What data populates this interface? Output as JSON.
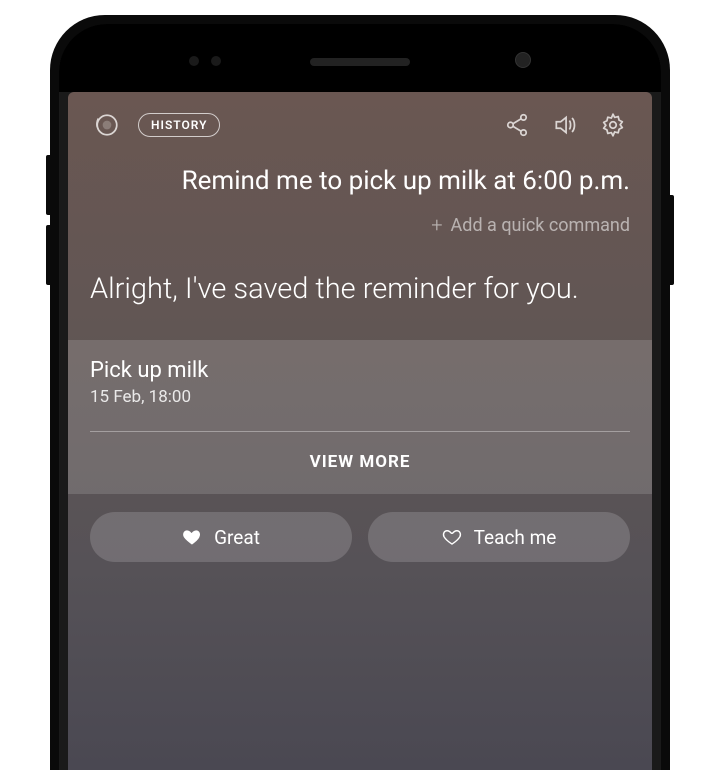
{
  "topbar": {
    "history_label": "HISTORY"
  },
  "conversation": {
    "user_utterance": "Remind me to pick up milk at 6:00 p.m.",
    "add_quick_command": "Add a quick command",
    "assistant_reply": "Alright, I've saved the reminder for you."
  },
  "reminder_card": {
    "title": "Pick up milk",
    "datetime": "15 Feb, 18:00",
    "view_more": "VIEW MORE"
  },
  "feedback_chips": {
    "great": "Great",
    "teach_me": "Teach me"
  }
}
